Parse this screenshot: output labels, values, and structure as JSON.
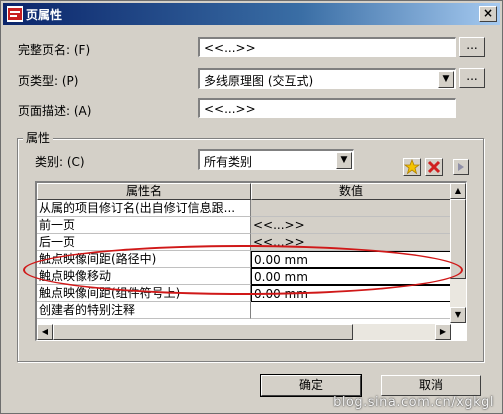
{
  "window": {
    "title": "页属性",
    "close": "×"
  },
  "fields": {
    "full_name_label": "完整页名: (F)",
    "full_name_value": "<<...>>",
    "page_type_label": "页类型: (P)",
    "page_type_value": "多线原理图 (交互式)",
    "description_label": "页面描述: (A)",
    "description_value": "<<...>>",
    "browse": "..."
  },
  "properties": {
    "group_title": "属性",
    "category_label": "类别: (C)",
    "category_value": "所有类别",
    "columns": [
      "属性名",
      "数值"
    ],
    "rows": [
      {
        "name": "从属的项目修订名(出自修订信息跟...",
        "value": ""
      },
      {
        "name": "前一页",
        "value": "<<...>>"
      },
      {
        "name": "后一页",
        "value": "<<...>>"
      },
      {
        "name": "触点映像间距(路径中)",
        "value": "0.00 mm"
      },
      {
        "name": "触点映像移动",
        "value": "0.00 mm"
      },
      {
        "name": "触点映像间距(组件符号上)",
        "value": "0.00 mm"
      },
      {
        "name": "创建者的特别注释",
        "value": ""
      }
    ]
  },
  "buttons": {
    "ok": "确定",
    "cancel": "取消"
  },
  "watermark": "blog.sina.com.cn/xgkgl",
  "colors": {
    "highlight_ellipse": "#d01818",
    "title_bar": "#0a246a"
  }
}
